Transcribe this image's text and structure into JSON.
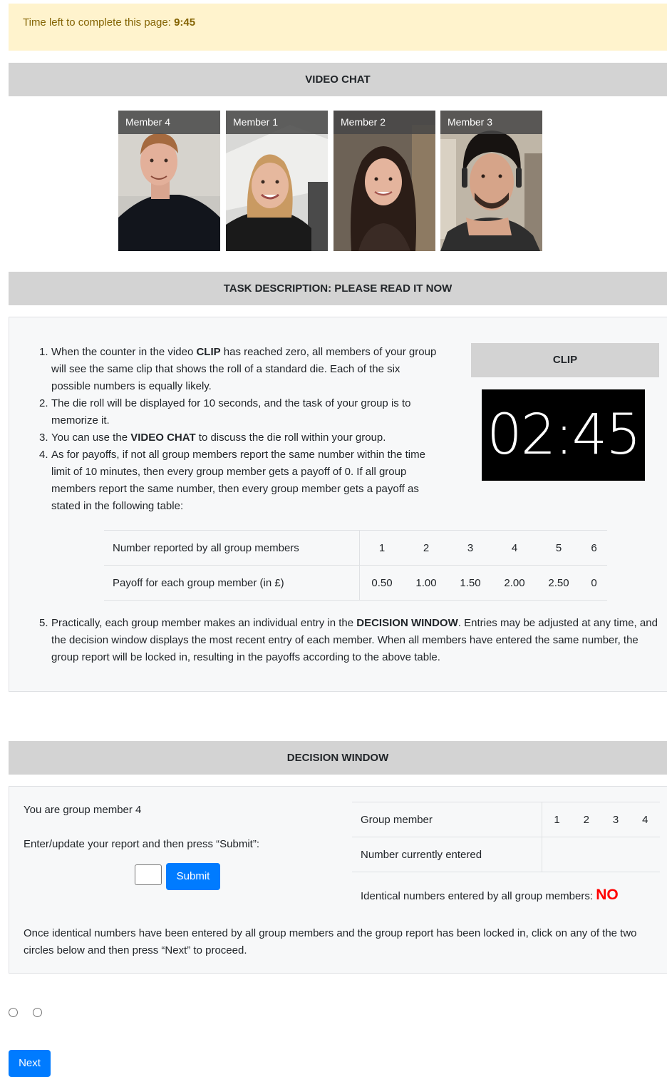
{
  "timer": {
    "prefix": "Time left to complete this page:",
    "value": "9:45"
  },
  "video_chat": {
    "title": "VIDEO CHAT",
    "members": [
      {
        "label": "Member 4"
      },
      {
        "label": "Member 1"
      },
      {
        "label": "Member 2"
      },
      {
        "label": "Member 3"
      }
    ]
  },
  "task": {
    "title": "TASK DESCRIPTION: PLEASE READ IT NOW",
    "items": [
      {
        "num": "1.",
        "parts": [
          "When the counter in the video ",
          "CLIP",
          " has reached zero, all members of your group will see the same clip that shows the roll of a standard die. Each of the six possible numbers is equally likely."
        ]
      },
      {
        "num": "2.",
        "parts": [
          "The die roll will be displayed for 10 seconds, and the task of your group is to memorize it."
        ]
      },
      {
        "num": "3.",
        "parts": [
          "You can use the ",
          "VIDEO CHAT",
          " to discuss the die roll within your group."
        ]
      },
      {
        "num": "4.",
        "parts": [
          "As for payoffs, if not all group members report the same number within the time limit of 10 minutes, then every group member gets a payoff of 0. If all group members report the same number, then every group member gets a payoff as stated in the following table:"
        ]
      },
      {
        "num": "5.",
        "parts": [
          "Practically, each group member makes an individual entry in the ",
          "DECISION WINDOW",
          ". Entries may be adjusted at any time, and the decision window displays the most recent entry of each member. When all members have entered the same number, the group report will be locked in, resulting in the payoffs according to the above table."
        ]
      }
    ],
    "clip_title": "CLIP",
    "clip_counter": "02:45",
    "payoff_table": {
      "row1_label": "Number reported by all group members",
      "row1_values": [
        "1",
        "2",
        "3",
        "4",
        "5",
        "6"
      ],
      "row2_label": "Payoff for each group member (in £)",
      "row2_values": [
        "0.50",
        "1.00",
        "1.50",
        "2.00",
        "2.50",
        "0"
      ]
    }
  },
  "decision": {
    "title": "DECISION WINDOW",
    "you_are": "You are group member 4",
    "instruction": "Enter/update your report and then press “Submit”:",
    "input_value": "",
    "submit_label": "Submit",
    "group_table": {
      "row1_label": "Group member",
      "members": [
        "1",
        "2",
        "3",
        "4"
      ],
      "row2_label": "Number currently entered",
      "entries": [
        "",
        "",
        "",
        ""
      ]
    },
    "identical_label": "Identical numbers entered by all group members:",
    "identical_value": "NO",
    "footer": "Once identical numbers have been entered by all group members and the group report has been locked in, click on any of the two circles below and then press “Next” to proceed."
  },
  "next_label": "Next"
}
